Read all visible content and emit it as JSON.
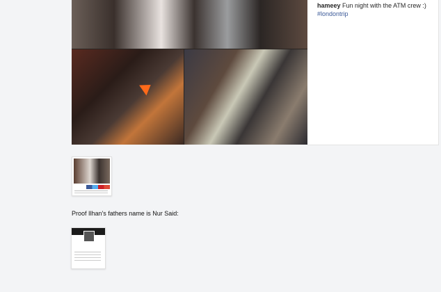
{
  "post": {
    "username": "hameey",
    "caption_text": " Fun night with the ATM crew :)",
    "hashtag": "#londontrip"
  },
  "article": {
    "proof_text": "Proof Ilhan's fathers name is Nur Said:"
  },
  "accent_colors": {
    "hashtag": "#3b5998",
    "arrow": "#ff6a1a"
  }
}
